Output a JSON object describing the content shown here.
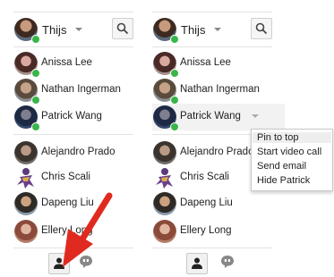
{
  "left_panel": {
    "me": {
      "name": "Thijs"
    },
    "pinned": [
      {
        "name": "Anissa Lee"
      },
      {
        "name": "Nathan Ingerman"
      },
      {
        "name": "Patrick Wang"
      }
    ],
    "contacts": [
      {
        "name": "Alejandro Prado"
      },
      {
        "name": "Chris Scali"
      },
      {
        "name": "Dapeng Liu"
      },
      {
        "name": "Ellery Long"
      }
    ]
  },
  "right_panel": {
    "me": {
      "name": "Thijs"
    },
    "pinned": [
      {
        "name": "Anissa Lee"
      },
      {
        "name": "Nathan Ingerman"
      },
      {
        "name": "Patrick Wang"
      }
    ],
    "contacts": [
      {
        "name": "Alejandro Prado"
      },
      {
        "name": "Chris Scali"
      },
      {
        "name": "Dapeng Liu"
      },
      {
        "name": "Ellery Long"
      }
    ]
  },
  "context_menu": {
    "items": [
      {
        "label": "Pin to top"
      },
      {
        "label": "Start video call"
      },
      {
        "label": "Send email"
      },
      {
        "label": "Hide Patrick"
      }
    ]
  },
  "colors": {
    "presence": "#39b54a",
    "arrow": "#e02a20"
  },
  "icons": [
    "search-icon",
    "person-icon",
    "chat-bubble-icon",
    "chevron-down-icon",
    "arrow-annotation"
  ]
}
